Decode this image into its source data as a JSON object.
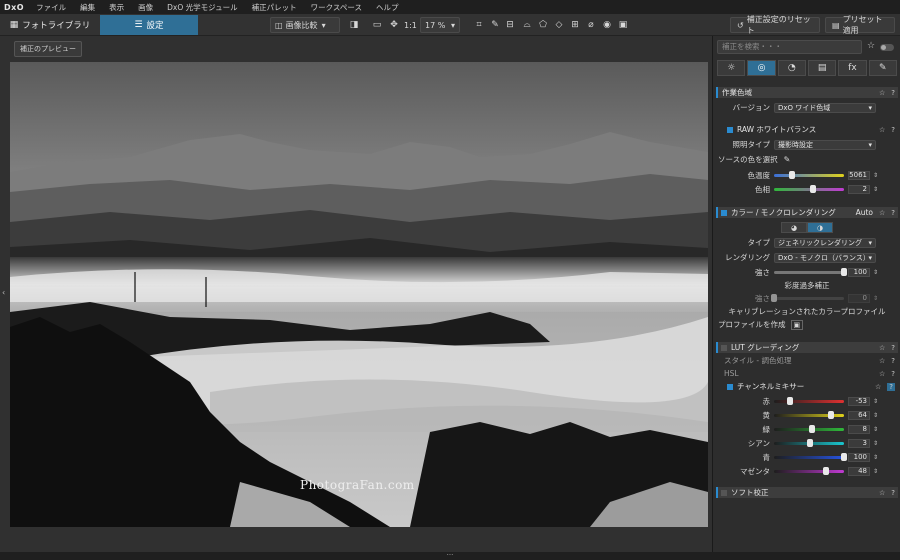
{
  "app": {
    "logo": "DxO"
  },
  "menu": [
    "ファイル",
    "編集",
    "表示",
    "画像",
    "DxO 光学モジュール",
    "補正パレット",
    "ワークスペース",
    "ヘルプ"
  ],
  "toolbar": {
    "tab_library": "フォトライブラリ",
    "tab_settings": "設定",
    "compare": "画像比較",
    "zoom_1to1": "1:1",
    "zoom_value": "17 %",
    "reset": "補正設定のリセット",
    "apply_preset": "プリセット適用"
  },
  "viewer": {
    "preview_label": "補正のプレビュー",
    "watermark": "PhotograFan.com"
  },
  "panel": {
    "search_placeholder": "補正を検索・・・",
    "tabs": [
      "☼",
      "◎",
      "◔",
      "▤",
      "fx",
      "✎"
    ],
    "working_space": {
      "title": "作業色域",
      "version_label": "バージョン",
      "version_value": "DxO ワイド色域"
    },
    "wb": {
      "title": "RAW ホワイトバランス",
      "lighting_label": "照明タイプ",
      "lighting_value": "撮影時設定",
      "source_label": "ソースの色を選択",
      "temp_label": "色温度",
      "temp_value": "5061",
      "tint_label": "色相",
      "tint_value": "2"
    },
    "color_render": {
      "title": "カラー / モノクロレンダリング",
      "auto": "Auto",
      "type_label": "タイプ",
      "type_value": "ジェネリックレンダリング",
      "render_label": "レンダリング",
      "render_value": "DxO - モノクロ（バランス）",
      "intensity_label": "強さ",
      "intensity_value": "100",
      "oversat_title": "彩度過多補正",
      "oversat_label": "強さ",
      "oversat_value": "0",
      "calibrated": "キャリブレーションされたカラープロファイル",
      "profile_create": "プロファイルを作成"
    },
    "lut": {
      "title": "LUT グレーディング"
    },
    "style": {
      "title": "スタイル - 調色処理"
    },
    "hsl": {
      "title": "HSL"
    },
    "mixer": {
      "title": "チャンネルミキサー",
      "channels": [
        {
          "label": "赤",
          "value": "-53",
          "fraction": 0.235,
          "color": "#e03131"
        },
        {
          "label": "黄",
          "value": "64",
          "fraction": 0.82,
          "color": "#e0d21b"
        },
        {
          "label": "緑",
          "value": "8",
          "fraction": 0.54,
          "color": "#2fb83a"
        },
        {
          "label": "シアン",
          "value": "3",
          "fraction": 0.515,
          "color": "#19c6cf"
        },
        {
          "label": "青",
          "value": "100",
          "fraction": 1.0,
          "color": "#2753e0"
        },
        {
          "label": "マゼンタ",
          "value": "48",
          "fraction": 0.74,
          "color": "#c13ad3"
        }
      ]
    },
    "soft": {
      "title": "ソフト校正"
    }
  },
  "levels": {
    "temp_fraction": 0.26,
    "tint_fraction": 0.55,
    "intensity_fraction": 1.0
  },
  "colors": {
    "accent": "#2f6f96",
    "section_marker": "#2a8bd0"
  }
}
